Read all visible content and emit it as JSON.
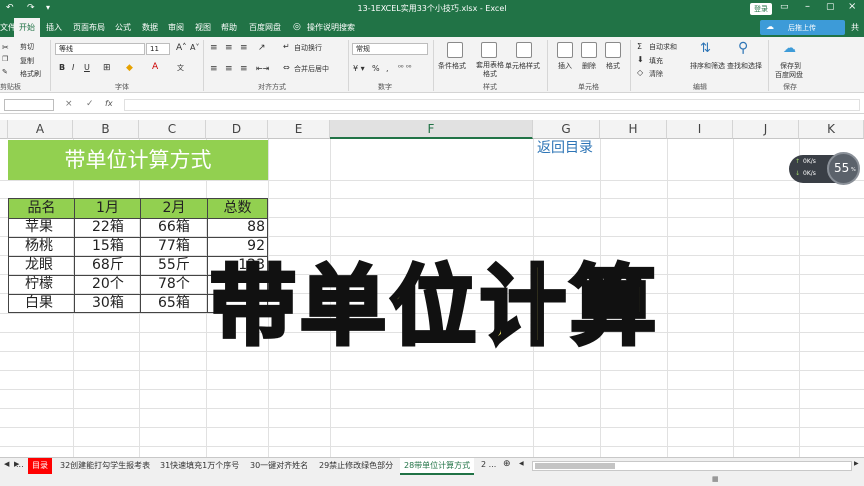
{
  "window": {
    "title": "13-1EXCEL实用33个小技巧.xlsx - Excel",
    "login": "登录"
  },
  "ribbon_tabs": [
    "文件",
    "开始",
    "插入",
    "页面布局",
    "公式",
    "数据",
    "审阅",
    "视图",
    "帮助",
    "百度网盘",
    "操作说明搜索"
  ],
  "upload_label": "后拖上传",
  "user_initial": "共",
  "clipboard": {
    "cut": "剪切",
    "copy": "复制",
    "painter": "格式刷",
    "paste": "粘贴",
    "group": "剪贴板"
  },
  "font": {
    "name": "等线",
    "size": "11",
    "group": "字体",
    "bold": "B",
    "italic": "I",
    "underline": "U",
    "wen": "文"
  },
  "alignment": {
    "wrap": "自动换行",
    "merge": "合并后居中",
    "group": "对齐方式"
  },
  "number": {
    "format": "常规",
    "group": "数字"
  },
  "styles": {
    "conditional": "条件格式",
    "table": "套用表格格式",
    "cell_styles": "单元格样式",
    "group": "样式"
  },
  "cells": {
    "insert": "插入",
    "delete": "删除",
    "format": "格式",
    "group": "单元格"
  },
  "editing": {
    "autosum": "自动求和",
    "fill": "填充",
    "clear": "清除",
    "sort": "排序和筛选",
    "find": "查找和选择",
    "group": "编辑"
  },
  "save": {
    "label1": "保存到",
    "label2": "百度网盘",
    "group": "保存"
  },
  "formula": {
    "cancel": "×",
    "enter": "✓",
    "fx": "fx",
    "value": ""
  },
  "columns": [
    "A",
    "B",
    "C",
    "D",
    "E",
    "F",
    "G",
    "H",
    "I",
    "J",
    "K"
  ],
  "sheet": {
    "title": "带单位计算方式",
    "link": "返回目录",
    "headers": [
      "品名",
      "1月",
      "2月",
      "总数"
    ],
    "rows": [
      [
        "苹果",
        "22箱",
        "66箱",
        "88"
      ],
      [
        "杨桃",
        "15箱",
        "77箱",
        "92"
      ],
      [
        "龙眼",
        "68斤",
        "55斤",
        "123"
      ],
      [
        "柠檬",
        "20个",
        "78个",
        ""
      ],
      [
        "白果",
        "30箱",
        "65箱",
        ""
      ]
    ]
  },
  "overlay_text": "带单位计算",
  "speed_widget": {
    "up": "0K/s",
    "down": "0K/s",
    "percent": "55",
    "unit": "%"
  },
  "sheet_tabs": [
    "...",
    "目录",
    "32创建能打勾学生报考表",
    "31快速填充1万个序号",
    "30一键对齐姓名",
    "29禁止修改绿色部分",
    "28带单位计算方式",
    "2 ..."
  ],
  "active_sheet_tab": "28带单位计算方式",
  "colors": {
    "excel_green": "#217346",
    "title_fill": "#92d050",
    "link_blue": "#2e75b6",
    "overlay_yellow": "#fff66a",
    "tab_red": "#ff0000"
  }
}
